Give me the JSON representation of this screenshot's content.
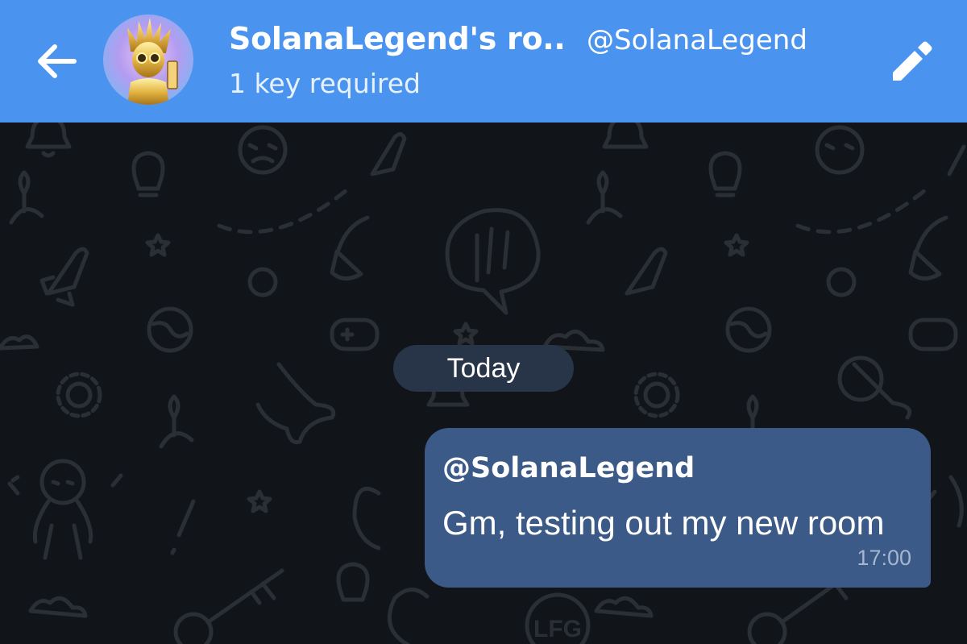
{
  "header": {
    "back_icon": "arrow-left-icon",
    "room_title": "SolanaLegend's ro...",
    "handle": "@SolanaLegend",
    "subtitle": "1 key required",
    "edit_icon": "pencil-icon",
    "color": "#4a94f0"
  },
  "chat": {
    "date_separator": "Today",
    "messages": [
      {
        "author": "@SolanaLegend",
        "text": "Gm, testing out my new room",
        "time": "17:00",
        "bubble_color": "#3b5a87"
      }
    ]
  },
  "colors": {
    "background": "#111418",
    "date_pill": "#283548"
  }
}
